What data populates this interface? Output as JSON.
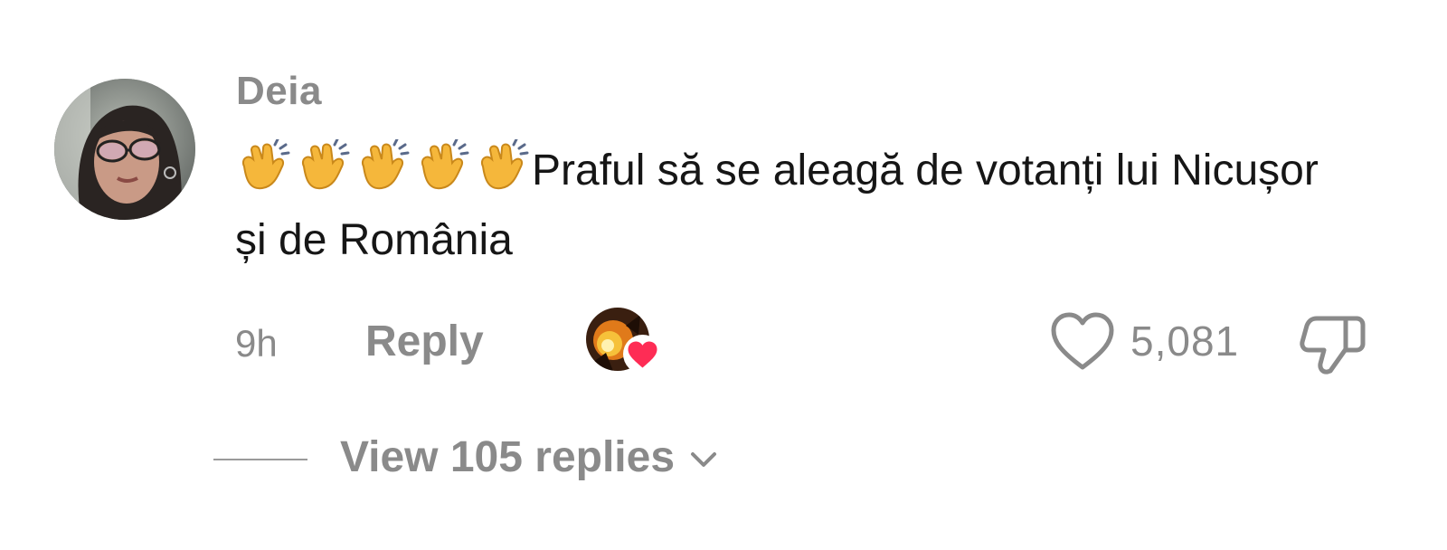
{
  "comment": {
    "username": "Deia",
    "emoji_prefix": "👏👏👏👏👏",
    "text": "Praful să se aleagă de votanți lui Nicușor și de România",
    "time": "9h",
    "reply_label": "Reply",
    "like_count": "5,081",
    "liked_by_creator": true
  },
  "replies": {
    "label": "View 105 replies"
  },
  "icons": {
    "avatar": "user-avatar",
    "creator_avatar": "creator-avatar",
    "creator_heart": "heart-icon",
    "clap": "clapping-hands-icon",
    "like": "heart-outline-icon",
    "dislike": "thumbs-down-icon",
    "expand": "chevron-down-icon"
  },
  "colors": {
    "muted_text": "#8a8a8a",
    "body_text": "#161616",
    "heart_red": "#fe2c55",
    "background": "#ffffff"
  }
}
